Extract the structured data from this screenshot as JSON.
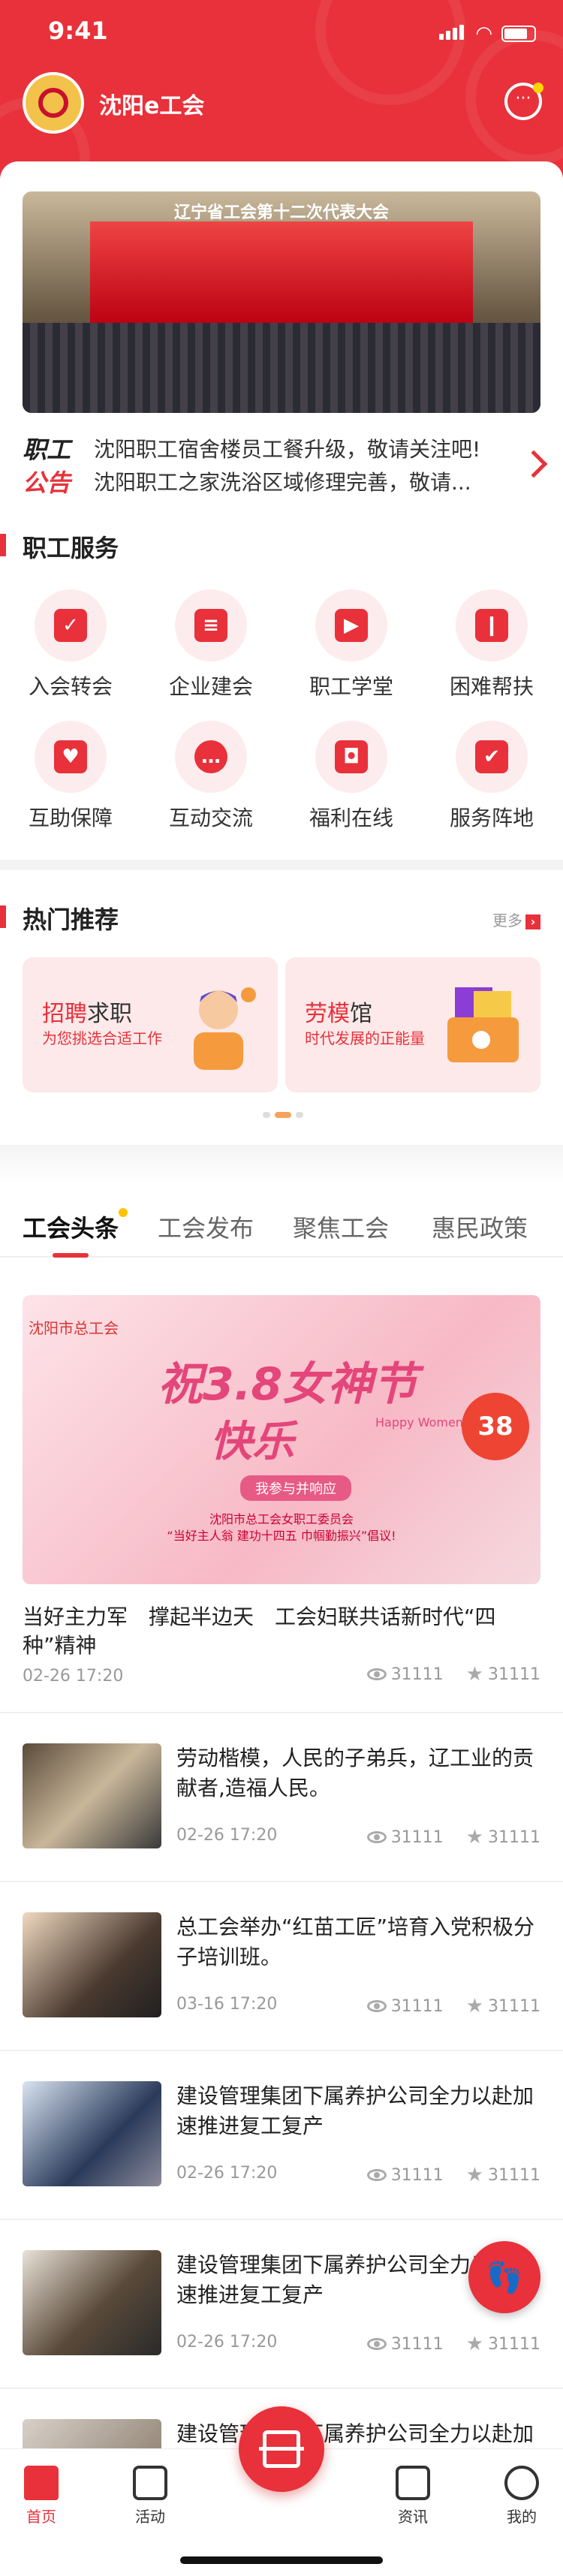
{
  "status": {
    "time": "9:41"
  },
  "app": {
    "title": "沈阳e工会"
  },
  "banner": {
    "title": "辽宁省工会第十二次代表大会"
  },
  "notice": {
    "tag_1": "职工",
    "tag_2": "公告",
    "items": [
      "沈阳职工宿舍楼员工餐升级，敬请关注吧!",
      "沈阳职工之家洗浴区域修理完善，敬请..."
    ]
  },
  "services": {
    "title": "职工服务",
    "items": [
      {
        "label": "入会转会",
        "icon": "membership-icon"
      },
      {
        "label": "企业建会",
        "icon": "enterprise-icon"
      },
      {
        "label": "职工学堂",
        "icon": "video-class-icon"
      },
      {
        "label": "困难帮扶",
        "icon": "aid-icon"
      },
      {
        "label": "互助保障",
        "icon": "heart-shield-icon"
      },
      {
        "label": "互动交流",
        "icon": "chat-icon"
      },
      {
        "label": "福利在线",
        "icon": "gift-bag-icon"
      },
      {
        "label": "服务阵地",
        "icon": "calendar-location-icon"
      }
    ]
  },
  "recommend": {
    "title": "热门推荐",
    "more": "更多",
    "cards": [
      {
        "title_hl": "招聘",
        "title_rest": "求职",
        "subtitle": "为您挑选合适工作"
      },
      {
        "title_hl": "劳模",
        "title_rest": "馆",
        "subtitle": "时代发展的正能量"
      }
    ]
  },
  "news_tabs": [
    "工会头条",
    "工会发布",
    "聚焦工会",
    "惠民政策"
  ],
  "feature": {
    "org": "沈阳市总工会",
    "h1": "祝3.8女神节",
    "h2": "快乐",
    "en": "Happy Women's Day",
    "button": "我参与并响应",
    "line1": "沈阳市总工会女职工委员会",
    "line2": "“当好主人翁 建功十四五 巾帼勤振兴”倡议!",
    "heart": "38",
    "title": "当好主力军　撑起半边天　工会妇联共话新时代“四种”精神",
    "date": "02-26 17:20",
    "views": "31111",
    "likes": "31111"
  },
  "news": [
    {
      "title": "劳动楷模，人民的子弟兵，辽工业的贡献者,造福人民。",
      "date": "02-26 17:20",
      "views": "31111",
      "likes": "31111"
    },
    {
      "title": "总工会举办“红苗工匠”培育入党积极分子培训班。",
      "date": "03-16 17:20",
      "views": "31111",
      "likes": "31111"
    },
    {
      "title": "建设管理集团下属养护公司全力以赴加速推进复工复产",
      "date": "02-26 17:20",
      "views": "31111",
      "likes": "31111"
    },
    {
      "title": "建设管理集团下属养护公司全力以赴加速推进复工复产",
      "date": "02-26 17:20",
      "views": "31111",
      "likes": "31111"
    },
    {
      "title": "建设管理集团下属养护公司全力以赴加速推进复工复产",
      "date": "",
      "views": "",
      "likes": ""
    }
  ],
  "tabbar": [
    {
      "label": "首页",
      "icon": "home-icon"
    },
    {
      "label": "活动",
      "icon": "gift-icon"
    },
    {
      "label": "资讯",
      "icon": "document-icon"
    },
    {
      "label": "我的",
      "icon": "user-icon"
    }
  ]
}
